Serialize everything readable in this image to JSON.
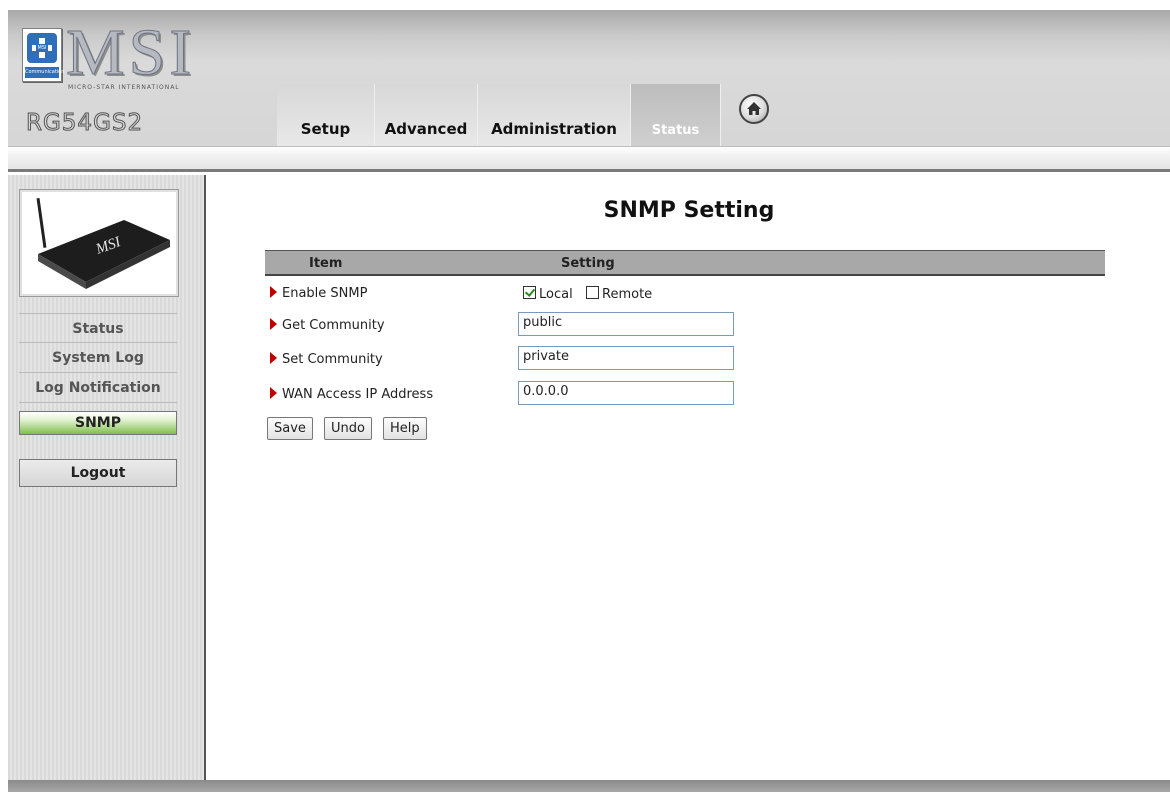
{
  "header": {
    "brand": "MSI",
    "brand_subtitle": "MICRO-STAR INTERNATIONAL",
    "emblem_text": "MSI",
    "emblem_strip": "Communication",
    "model": "RG54GS2",
    "tabs": [
      {
        "label": "Setup",
        "active": false
      },
      {
        "label": "Advanced",
        "active": false
      },
      {
        "label": "Administration",
        "active": false
      },
      {
        "label": "Status",
        "active": true
      }
    ],
    "home_icon": "home-icon"
  },
  "sidebar": {
    "device_label": "MSI",
    "items": [
      {
        "label": "Status",
        "active": false
      },
      {
        "label": "System Log",
        "active": false
      },
      {
        "label": "Log Notification",
        "active": false
      },
      {
        "label": "SNMP",
        "active": true
      }
    ],
    "logout": "Logout"
  },
  "main": {
    "title": "SNMP Setting",
    "table": {
      "col_item": "Item",
      "col_setting": "Setting",
      "rows": [
        {
          "label": "Enable SNMP"
        },
        {
          "label": "Get Community",
          "value": "public"
        },
        {
          "label": "Set Community",
          "value": "private"
        },
        {
          "label": "WAN Access IP Address",
          "value": "0.0.0.0"
        }
      ]
    },
    "snmp": {
      "local_label": "Local",
      "local_checked": true,
      "remote_label": "Remote",
      "remote_checked": false
    },
    "buttons": {
      "save": "Save",
      "undo": "Undo",
      "help": "Help"
    }
  },
  "colors": {
    "accent_green": "#7fbf4d",
    "arrow_red": "#c00000",
    "header_gray": "#a8a8a8"
  }
}
